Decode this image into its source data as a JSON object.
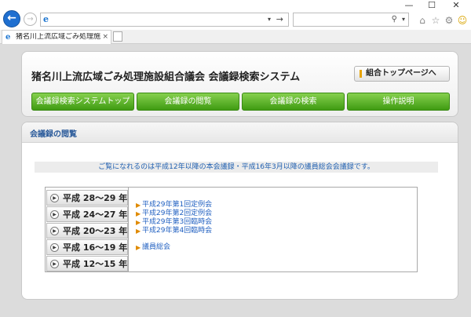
{
  "browser": {
    "address_value": "",
    "search_value": "",
    "tab_title": "猪名川上流広域ごみ処理施...",
    "ie_glyph": "e",
    "buttons": {
      "back": "←",
      "forward": "→",
      "dropdown": "▾",
      "go": "→",
      "search": "⚲",
      "minimize": "—",
      "maximize": "☐",
      "close": "✕",
      "tab_close": "×"
    },
    "tools": {
      "home": "⌂",
      "favorites": "☆",
      "settings": "⚙",
      "smile": "☺"
    }
  },
  "header": {
    "title": "猪名川上流広域ごみ処理施設組合議会 会議録検索システム",
    "top_link": "組合トップページへ"
  },
  "menu": [
    {
      "label": "会議録検索システムトップ"
    },
    {
      "label": "会議録の閲覧"
    },
    {
      "label": "会議録の検索"
    },
    {
      "label": "操作説明"
    }
  ],
  "section": {
    "title": "会議録の閲覧",
    "notice": "ご覧になれるのは平成12年以降の本会議録・平成16年3月以降の議員総会会議録です。"
  },
  "eras": [
    {
      "label": "平成 28～29 年"
    },
    {
      "label": "平成 24～27 年"
    },
    {
      "label": "平成 20～23 年"
    },
    {
      "label": "平成 16～19 年"
    },
    {
      "label": "平成 12～15 年"
    }
  ],
  "era_arrow": "▶",
  "links": [
    {
      "label": "平成29年第1回定例会"
    },
    {
      "label": "平成29年第2回定例会"
    },
    {
      "label": "平成29年第3回臨時会"
    },
    {
      "label": "平成29年第4回臨時会"
    },
    {
      "label": "議員総会"
    }
  ],
  "link_arrow": "▶",
  "colors": {
    "menu_green": "#3f9b12",
    "link_blue": "#1f5fc0",
    "notice_blue": "#1f5fb0",
    "accent_orange": "#e08a00",
    "browser_blue": "#1f6fd0"
  },
  "icons": {
    "back": "arrow-left-icon",
    "forward": "arrow-right-icon",
    "search": "magnifier-icon",
    "home": "home-icon",
    "favorites": "star-icon",
    "settings": "gear-icon",
    "feedback": "smiley-icon",
    "era": "play-circle-icon",
    "link": "triangle-right-icon"
  }
}
